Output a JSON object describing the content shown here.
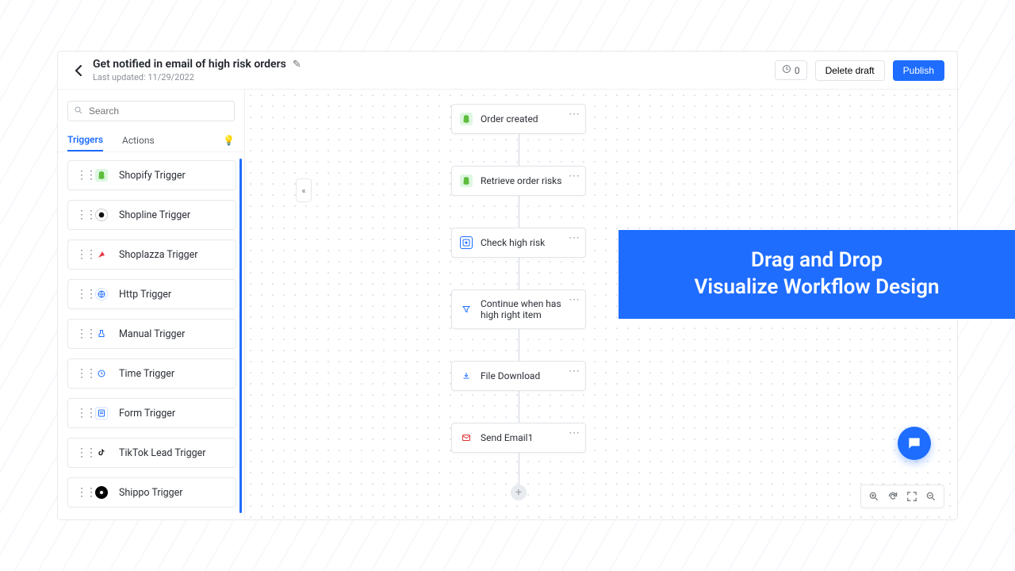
{
  "header": {
    "title": "Get notified in email of high risk orders",
    "last_updated_label": "Last updated: 11/29/2022",
    "history_count": "0",
    "delete_label": "Delete draft",
    "publish_label": "Publish"
  },
  "search": {
    "placeholder": "Search"
  },
  "tabs": {
    "triggers": "Triggers",
    "actions": "Actions"
  },
  "triggers": [
    {
      "label": "Shopify Trigger",
      "icon": "shopify"
    },
    {
      "label": "Shopline Trigger",
      "icon": "shopline"
    },
    {
      "label": "Shoplazza Trigger",
      "icon": "shoplazza"
    },
    {
      "label": "Http Trigger",
      "icon": "http"
    },
    {
      "label": "Manual Trigger",
      "icon": "manual"
    },
    {
      "label": "Time Trigger",
      "icon": "time"
    },
    {
      "label": "Form Trigger",
      "icon": "form"
    },
    {
      "label": "TikTok Lead Trigger",
      "icon": "tiktok"
    },
    {
      "label": "Shippo Trigger",
      "icon": "shippo"
    }
  ],
  "nodes": [
    {
      "label": "Order created",
      "icon": "shopify"
    },
    {
      "label": "Retrieve order risks",
      "icon": "shopify"
    },
    {
      "label": "Check high risk",
      "icon": "check"
    },
    {
      "label": "Continue when has high right item",
      "icon": "filter"
    },
    {
      "label": "File Download",
      "icon": "download"
    },
    {
      "label": "Send Email1",
      "icon": "mail"
    }
  ],
  "promo": {
    "line1": "Drag and Drop",
    "line2": "Visualize Workflow Design"
  }
}
